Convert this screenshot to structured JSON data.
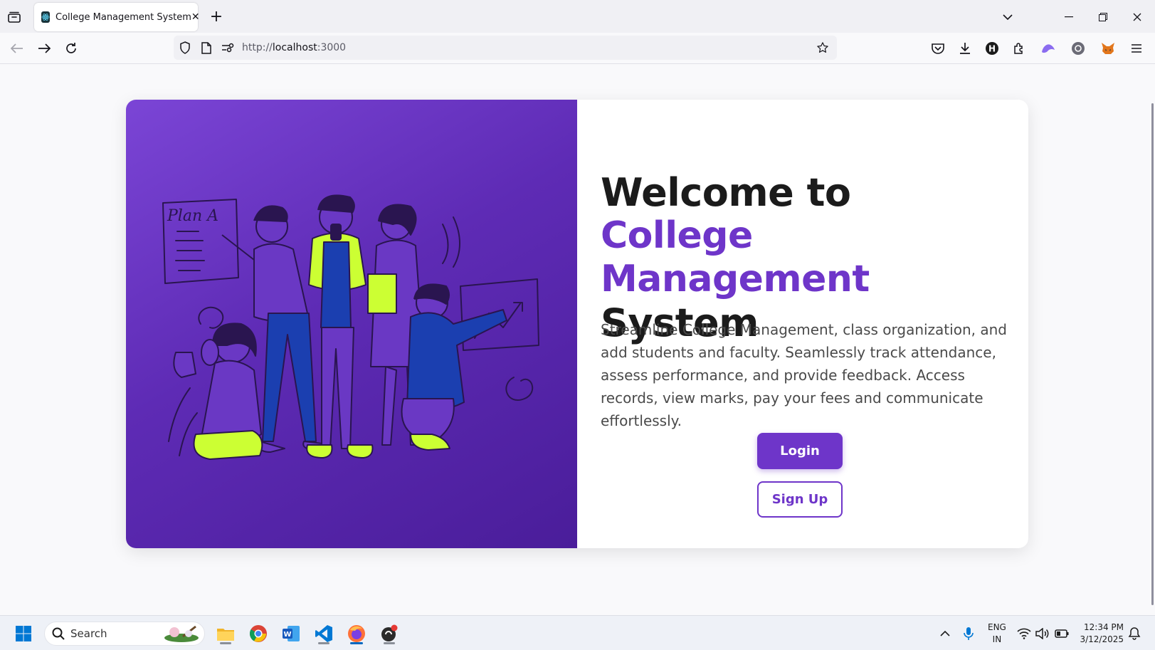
{
  "browser": {
    "tab_title": "College Management System",
    "url_prefix": "http://",
    "url_host": "localhost",
    "url_port": ":3000"
  },
  "page": {
    "headline_line1": "Welcome to",
    "headline_accent": "College Management",
    "headline_line3": "System",
    "description": "Streamline College Management, class organization, and add students and faculty. Seamlessly track attendance, assess performance, and provide feedback. Access records, view marks, pay your fees and communicate effortlessly.",
    "login_label": "Login",
    "signup_label": "Sign Up",
    "illustration_text": "Plan A",
    "accent_color": "#6e35c9"
  },
  "taskbar": {
    "search_label": "Search",
    "lang_line1": "ENG",
    "lang_line2": "IN",
    "time": "12:34 PM",
    "date": "3/12/2025"
  }
}
